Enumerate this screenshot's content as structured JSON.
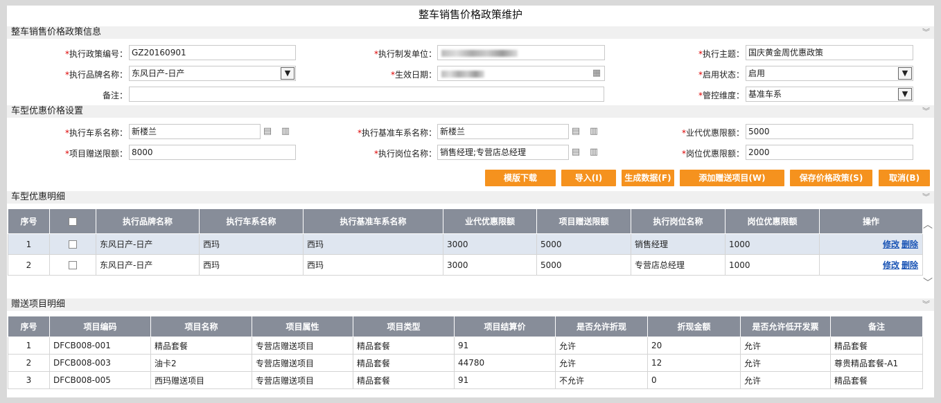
{
  "page_title": "整车销售价格政策维护",
  "sections": {
    "policy_info": "整车销售价格政策信息",
    "model_pricing": "车型优惠价格设置",
    "model_detail": "车型优惠明细",
    "gift_detail": "赠送项目明细"
  },
  "form": {
    "policy_no_label": "执行政策编号：",
    "policy_no": "GZ20160901",
    "issuer_label": "执行制发单位：",
    "theme_label": "执行主题：",
    "theme": "国庆黄金周优惠政策",
    "brand_label": "执行品牌名称：",
    "brand": "东风日产-日产",
    "effective_label": "生效日期：",
    "status_label": "启用状态：",
    "status": "启用",
    "remark_label": "备注：",
    "remark": "",
    "control_label": "管控维度：",
    "control": "基准车系",
    "series_label": "执行车系名称：",
    "series": "新楼兰",
    "base_series_label": "执行基准车系名称：",
    "base_series": "新楼兰",
    "agent_limit_label": "业代优惠限额：",
    "agent_limit": "5000",
    "gift_limit_label": "项目赠送限额：",
    "gift_limit": "8000",
    "post_label": "执行岗位名称：",
    "post": "销售经理;专营店总经理",
    "post_limit_label": "岗位优惠限额：",
    "post_limit": "2000"
  },
  "buttons": {
    "template": "模版下载",
    "import": "导入(I)",
    "generate": "生成数据(F)",
    "add_gift": "添加赠送项目(W)",
    "save": "保存价格政策(S)",
    "cancel": "取消(B)"
  },
  "model_table": {
    "headers": [
      "序号",
      "",
      "执行品牌名称",
      "执行车系名称",
      "执行基准车系名称",
      "业代优惠限额",
      "项目赠送限额",
      "执行岗位名称",
      "岗位优惠限额",
      "操作"
    ],
    "edit_label": "修改",
    "delete_label": "删除",
    "rows": [
      {
        "no": "1",
        "brand": "东风日产-日产",
        "series": "西玛",
        "base": "西玛",
        "agent": "3000",
        "gift": "5000",
        "post": "销售经理",
        "post_limit": "1000"
      },
      {
        "no": "2",
        "brand": "东风日产-日产",
        "series": "西玛",
        "base": "西玛",
        "agent": "3000",
        "gift": "5000",
        "post": "专营店总经理",
        "post_limit": "1000"
      }
    ]
  },
  "gift_table": {
    "headers": [
      "序号",
      "项目编码",
      "项目名称",
      "项目属性",
      "项目类型",
      "项目结算价",
      "是否允许折现",
      "折现金额",
      "是否允许低开发票",
      "备注"
    ],
    "rows": [
      {
        "no": "1",
        "code": "DFCB008-001",
        "name": "精品套餐",
        "attr": "专营店赠送项目",
        "type": "精品套餐",
        "price": "91",
        "cash": "允许",
        "amount": "20",
        "invoice": "允许",
        "remark": "精品套餐"
      },
      {
        "no": "2",
        "code": "DFCB008-003",
        "name": "油卡2",
        "attr": "专营店赠送项目",
        "type": "精品套餐",
        "price": "44780",
        "cash": "允许",
        "amount": "12",
        "invoice": "允许",
        "remark": "尊贵精品套餐-A1"
      },
      {
        "no": "3",
        "code": "DFCB008-005",
        "name": "西玛赠送项目",
        "attr": "专营店赠送项目",
        "type": "精品套餐",
        "price": "91",
        "cash": "不允许",
        "amount": "0",
        "invoice": "允许",
        "remark": "精品套餐"
      }
    ]
  }
}
